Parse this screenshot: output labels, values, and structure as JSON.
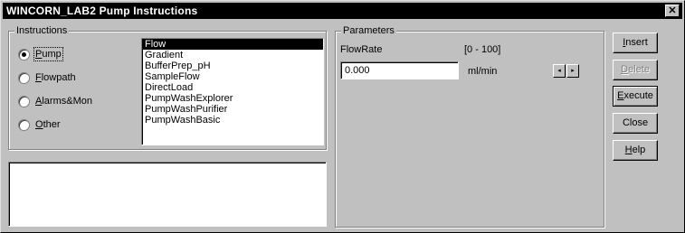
{
  "window": {
    "title": "WINCORN_LAB2 Pump Instructions",
    "close_glyph": "✕"
  },
  "instructions": {
    "group_label": "Instructions",
    "radios": [
      {
        "accel": "P",
        "rest": "ump",
        "selected": true
      },
      {
        "accel": "F",
        "rest": "lowpath",
        "selected": false
      },
      {
        "accel": "A",
        "rest": "larms&Mon",
        "selected": false
      },
      {
        "accel": "O",
        "rest": "ther",
        "selected": false
      }
    ],
    "list_items": [
      "Flow",
      "Gradient",
      "BufferPrep_pH",
      "SampleFlow",
      "DirectLoad",
      "PumpWashExplorer",
      "PumpWashPurifier",
      "PumpWashBasic"
    ],
    "selected_item": "Flow",
    "comment_text": ""
  },
  "parameters": {
    "group_label": "Parameters",
    "name": "FlowRate",
    "range": "[0 - 100]",
    "value": "0.000",
    "unit": "ml/min",
    "spin_left": "◂",
    "spin_right": "▸"
  },
  "buttons": {
    "insert": {
      "accel": "I",
      "rest": "nsert",
      "enabled": true
    },
    "delete": {
      "accel": "D",
      "rest": "elete",
      "enabled": false
    },
    "execute": {
      "accel": "E",
      "rest": "xecute",
      "enabled": true
    },
    "close": {
      "label": "Close",
      "enabled": true
    },
    "help": {
      "accel": "H",
      "rest": "elp",
      "enabled": true
    }
  }
}
